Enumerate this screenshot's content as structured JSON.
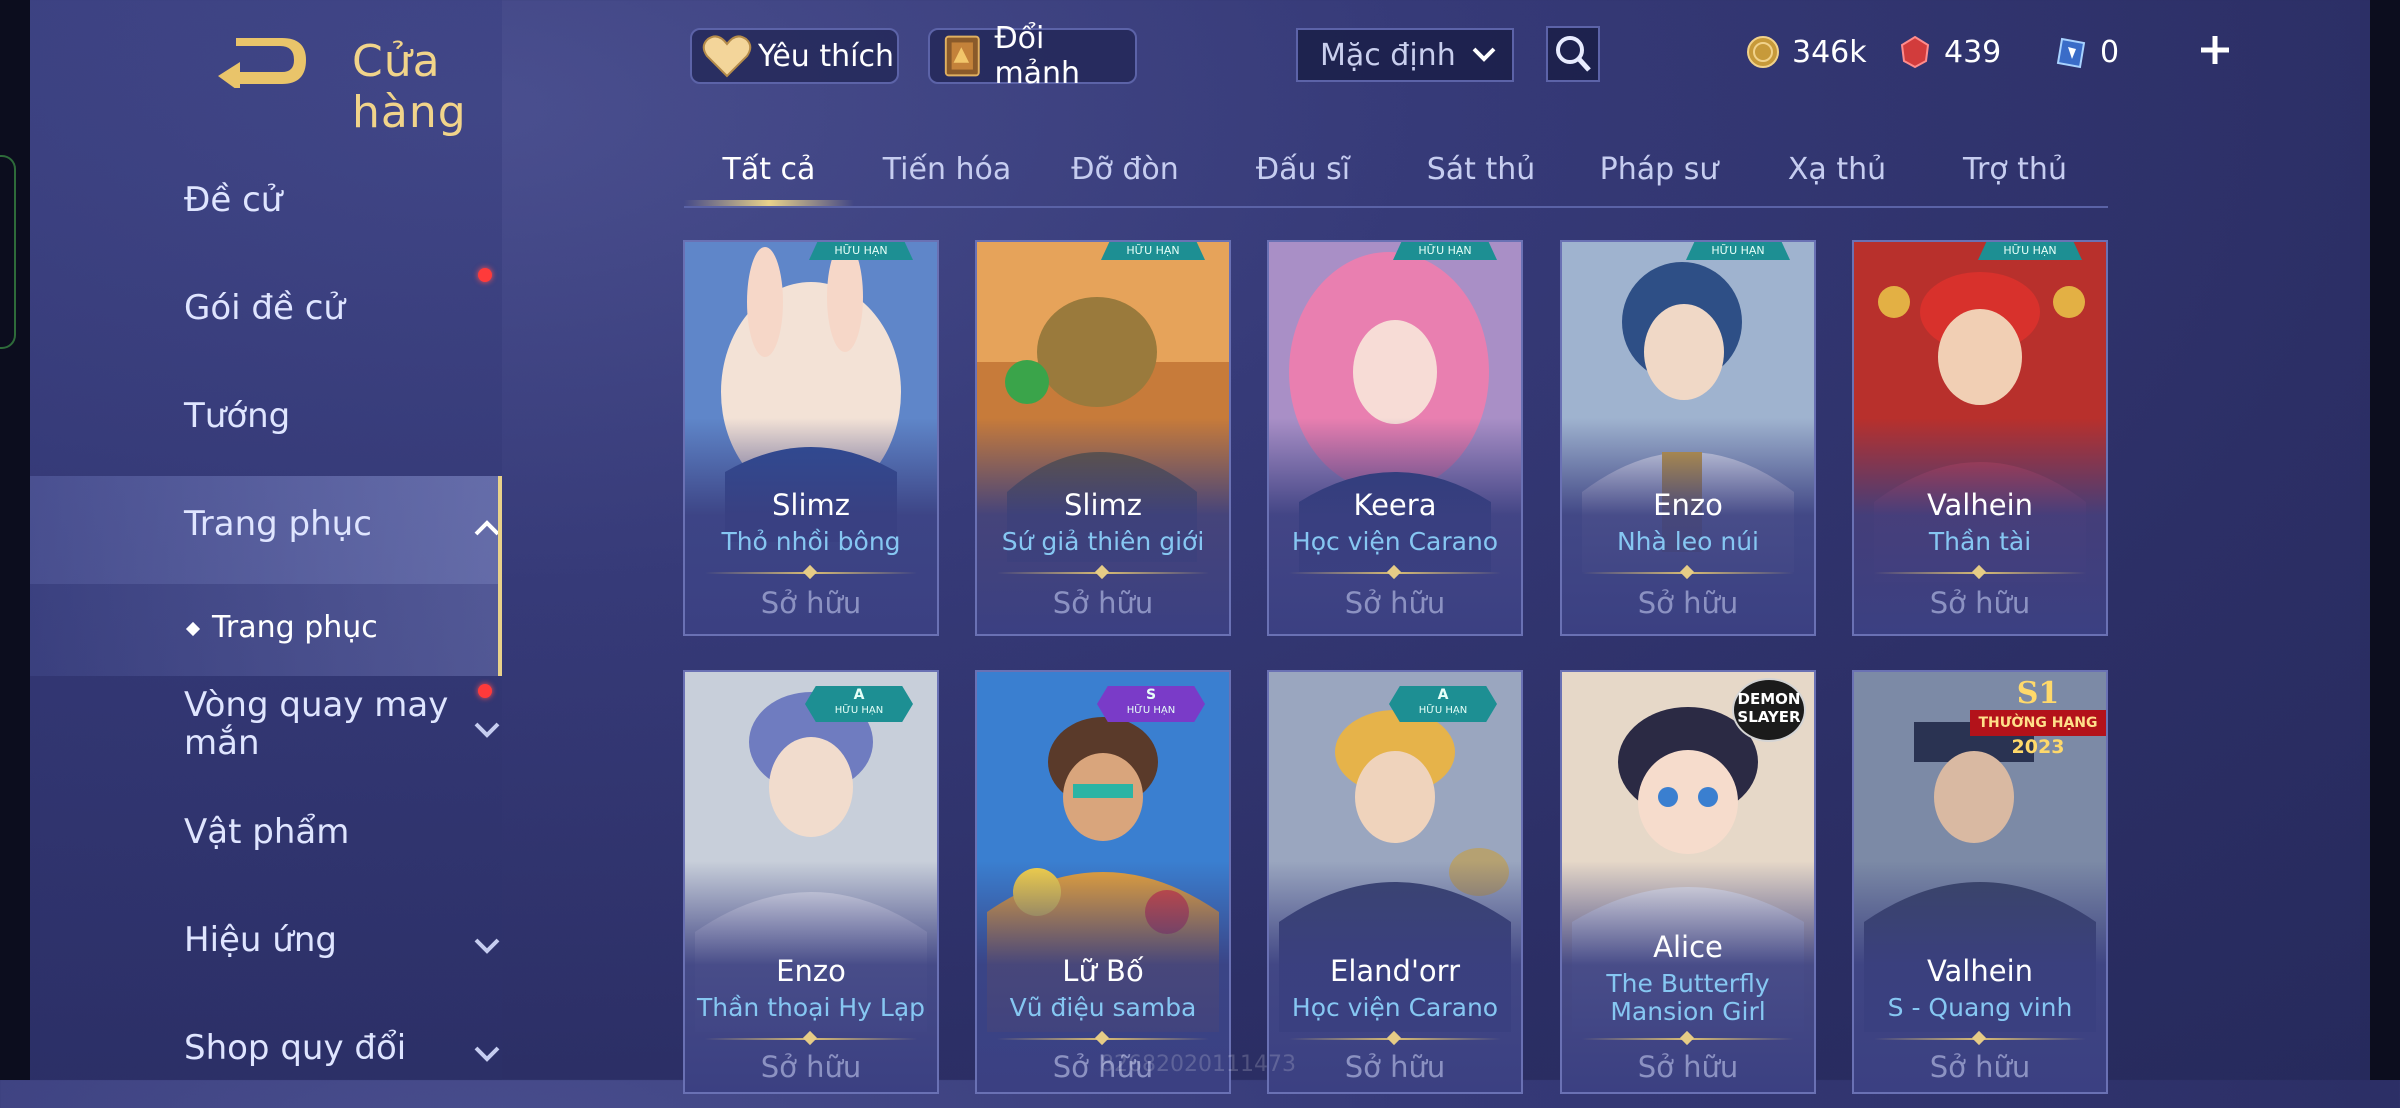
{
  "header": {
    "title": "Cửa hàng",
    "favorite_label": "Yêu thích",
    "exchange_label": "Đổi mảnh",
    "sort_label": "Mặc định"
  },
  "currency": {
    "gold": "346k",
    "ruby": "439",
    "ticket": "0"
  },
  "sidebar": {
    "items": [
      {
        "label": "Đề cử"
      },
      {
        "label": "Gói đề cử"
      },
      {
        "label": "Tướng"
      },
      {
        "label": "Trang phục"
      },
      {
        "label": "Trang phục"
      },
      {
        "label": "Vòng quay may mắn"
      },
      {
        "label": "Vật phẩm"
      },
      {
        "label": "Hiệu ứng"
      },
      {
        "label": "Shop quy đổi"
      }
    ]
  },
  "tabs": [
    "Tất cả",
    "Tiến hóa",
    "Đỡ đòn",
    "Đấu sĩ",
    "Sát thủ",
    "Pháp sư",
    "Xạ thủ",
    "Trợ thủ"
  ],
  "cards": [
    {
      "hero": "Slimz",
      "skin": "Thỏ nhồi bông",
      "status": "Sở hữu",
      "badge": "HỮU HẠN"
    },
    {
      "hero": "Slimz",
      "skin": "Sứ giả thiên giới",
      "status": "Sở hữu",
      "badge": "HỮU HẠN"
    },
    {
      "hero": "Keera",
      "skin": "Học viện Carano",
      "status": "Sở hữu",
      "badge": "HỮU HẠN"
    },
    {
      "hero": "Enzo",
      "skin": "Nhà leo núi",
      "status": "Sở hữu",
      "badge": "HỮU HẠN"
    },
    {
      "hero": "Valhein",
      "skin": "Thần tài",
      "status": "Sở hữu",
      "badge": "HỮU HẠN"
    },
    {
      "hero": "Enzo",
      "skin": "Thần thoại Hy Lạp",
      "status": "Sở hữu",
      "tier": "A",
      "badge": "HỮU HẠN"
    },
    {
      "hero": "Lữ Bố",
      "skin": "Vũ điệu samba",
      "status": "Sở hữu",
      "tier": "S",
      "badge": "HỮU HẠN"
    },
    {
      "hero": "Eland'orr",
      "skin": "Học viện Carano",
      "status": "Sở hữu",
      "tier": "A",
      "badge": "HỮU HẠN"
    },
    {
      "hero": "Alice",
      "skin": "The Butterfly Mansion Girl",
      "status": "Sở hữu",
      "collab": "DEMON SLAYER"
    },
    {
      "hero": "Valhein",
      "skin": "S - Quang vinh",
      "status": "Sở hữu",
      "rank_badge": {
        "top": "S1",
        "ribbon": "THƯỜNG HẠNG",
        "year": "2023"
      }
    }
  ],
  "watermark": "82682020111473",
  "colors": {
    "accent_gold": "#e9d28a",
    "skin_name": "#86c7f2",
    "notification_dot": "#ff3a3a",
    "badge_teal": "#1d8f93",
    "badge_purple": "#7a3bc8"
  }
}
